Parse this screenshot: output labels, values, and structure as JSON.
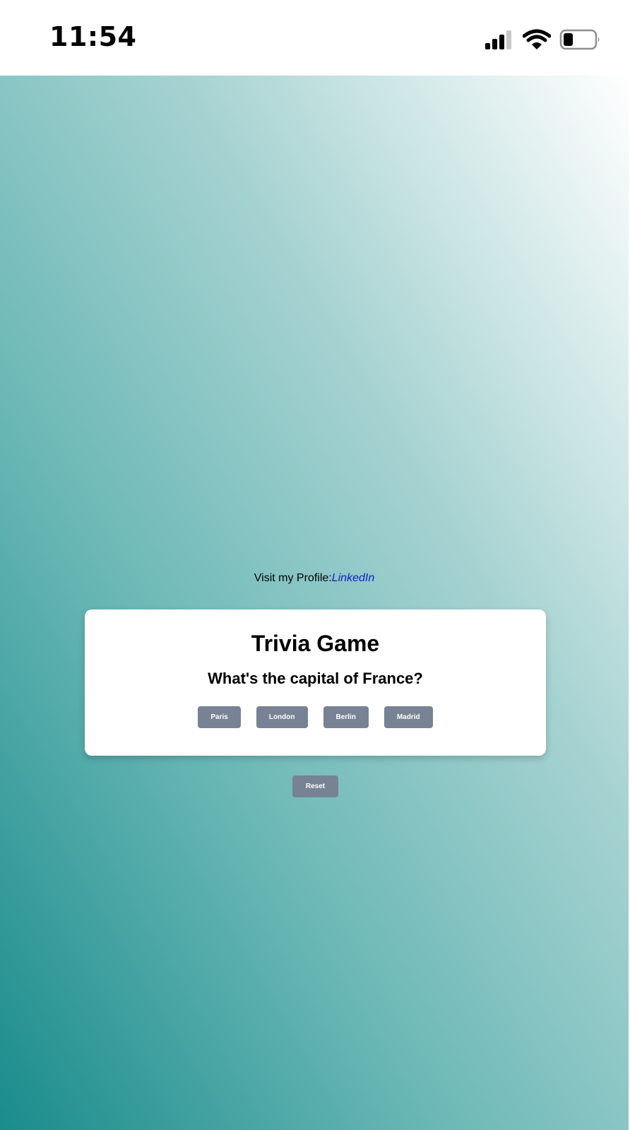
{
  "status_bar": {
    "time": "11:54",
    "icons": [
      "signal-icon",
      "wifi-icon",
      "battery-icon"
    ],
    "battery_level": 0.25
  },
  "profile": {
    "prefix": "Visit my Profile:",
    "link_label": "LinkedIn"
  },
  "card": {
    "title": "Trivia Game",
    "question": "What's the capital of France?",
    "options": [
      "Paris",
      "London",
      "Berlin",
      "Madrid"
    ]
  },
  "reset_label": "Reset",
  "colors": {
    "button": "#778294",
    "link": "#0b1fc2",
    "gradient_dark": "#1a8c8c",
    "gradient_light": "#ffffff"
  }
}
